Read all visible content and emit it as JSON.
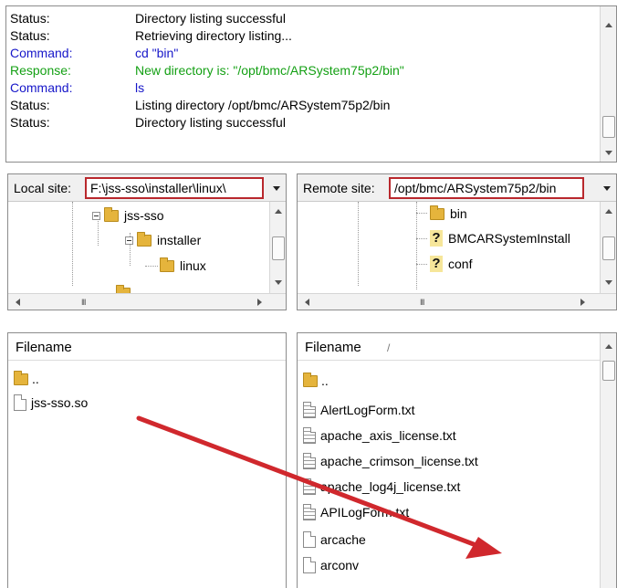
{
  "log": {
    "rows": [
      {
        "kind": "status",
        "label": "Status:",
        "text": "Directory listing successful"
      },
      {
        "kind": "status",
        "label": "Status:",
        "text": "Retrieving directory listing..."
      },
      {
        "kind": "command",
        "label": "Command:",
        "text": "cd \"bin\""
      },
      {
        "kind": "response",
        "label": "Response:",
        "text": "New directory is: \"/opt/bmc/ARSystem75p2/bin\""
      },
      {
        "kind": "command",
        "label": "Command:",
        "text": "ls"
      },
      {
        "kind": "status",
        "label": "Status:",
        "text": "Listing directory /opt/bmc/ARSystem75p2/bin"
      },
      {
        "kind": "status",
        "label": "Status:",
        "text": "Directory listing successful"
      }
    ]
  },
  "local_site": {
    "label": "Local site:",
    "path": "F:\\jss-sso\\installer\\linux\\",
    "tree": [
      {
        "name": "jss-sso",
        "icon": "folder-icon"
      },
      {
        "name": "installer",
        "icon": "folder-icon"
      },
      {
        "name": "linux",
        "icon": "folder-icon"
      }
    ]
  },
  "remote_site": {
    "label": "Remote site:",
    "path": "/opt/bmc/ARSystem75p2/bin",
    "tree": [
      {
        "name": "bin",
        "icon": "folder-icon"
      },
      {
        "name": "BMCARSystemInstall",
        "icon": "unknown-icon"
      },
      {
        "name": "conf",
        "icon": "unknown-icon"
      }
    ]
  },
  "local_files": {
    "header": "Filename",
    "items": [
      {
        "name": "..",
        "icon": "folder-icon"
      },
      {
        "name": "jss-sso.so",
        "icon": "file-icon"
      }
    ]
  },
  "remote_files": {
    "header": "Filename",
    "sort_indicator": "/",
    "items": [
      {
        "name": "..",
        "icon": "folder-icon"
      },
      {
        "name": "AlertLogForm.txt",
        "icon": "text-file-icon"
      },
      {
        "name": "apache_axis_license.txt",
        "icon": "text-file-icon"
      },
      {
        "name": "apache_crimson_license.txt",
        "icon": "text-file-icon"
      },
      {
        "name": "apache_log4j_license.txt",
        "icon": "text-file-icon"
      },
      {
        "name": "APILogForm.txt",
        "icon": "text-file-icon"
      },
      {
        "name": "arcache",
        "icon": "file-icon"
      },
      {
        "name": "arconv",
        "icon": "file-icon"
      }
    ]
  },
  "scroll_glyph": "III",
  "highlight_color": "#b9282d",
  "arrow_color": "#d0282d"
}
